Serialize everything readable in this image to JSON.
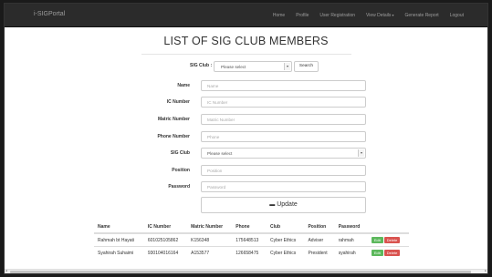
{
  "navbar": {
    "brand": "i-SIGPortal",
    "links": [
      "Home",
      "Profile",
      "User Registration",
      "View Details",
      "Generate Report",
      "Logout"
    ],
    "dropdown_caret": "▾"
  },
  "page": {
    "title": "LIST OF SIG CLUB MEMBERS"
  },
  "search": {
    "label": "SIG Club :",
    "select_value": "Please select",
    "button": "Search"
  },
  "form": {
    "fields": [
      {
        "label": "Name",
        "placeholder": "Name"
      },
      {
        "label": "IC Number",
        "placeholder": "IC Number"
      },
      {
        "label": "Matric Number",
        "placeholder": "Matric Number"
      },
      {
        "label": "Phone Number",
        "placeholder": "Phone"
      },
      {
        "label": "SIG Club",
        "select_value": "Please select"
      },
      {
        "label": "Position",
        "placeholder": "Position"
      },
      {
        "label": "Password",
        "placeholder": "Password"
      }
    ],
    "update_button": "Update"
  },
  "table": {
    "headers": [
      "Name",
      "IC Number",
      "Matric Number",
      "Phone",
      "Club",
      "Position",
      "Password"
    ],
    "rows": [
      [
        "Rahmah bt Hayati",
        "601025105862",
        "K156348",
        "175648513",
        "Cyber Ethics",
        "Adviser",
        "rahmah"
      ],
      [
        "Syahirah Suhaimi",
        "930104016164",
        "A153577",
        "126658475",
        "Cyber Ethics",
        "President",
        "syahirah"
      ]
    ],
    "edit_label": "Edit",
    "delete_label": "Delete"
  },
  "colors": {
    "navbar_bg": "#2b2b2b",
    "edit_btn": "#5cb85c",
    "delete_btn": "#d9534f"
  }
}
